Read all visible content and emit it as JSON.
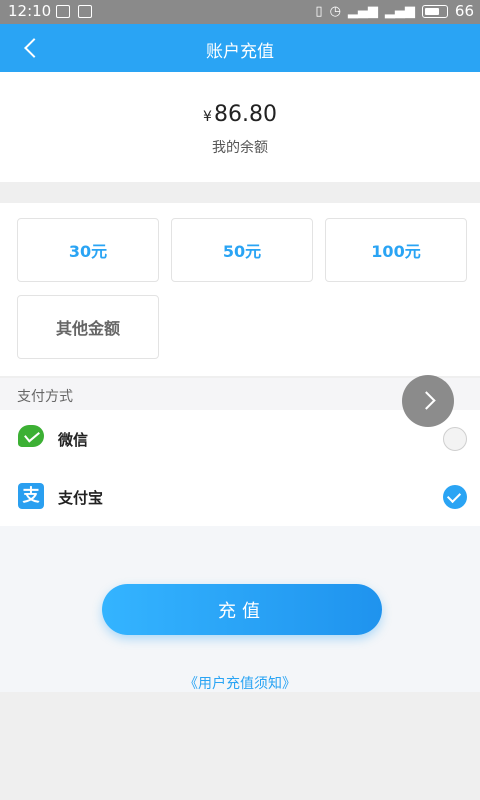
{
  "status_bar": {
    "time": "12:10",
    "battery": "66"
  },
  "header": {
    "title": "账户充值"
  },
  "balance": {
    "currency": "¥",
    "amount": "86.80",
    "label": "我的余额"
  },
  "recharge_options": [
    "30元",
    "50元",
    "100元",
    "其他金额"
  ],
  "payment": {
    "section_title": "支付方式",
    "methods": [
      {
        "label": "微信",
        "selected": false,
        "icon": "wechat-icon"
      },
      {
        "label": "支付宝",
        "selected": true,
        "icon": "alipay-icon",
        "icon_glyph": "支"
      }
    ]
  },
  "submit_button": "充值",
  "notice_link": "《用户充值须知》",
  "colors": {
    "accent": "#2aa4f4",
    "wechat_green": "#3cb034"
  }
}
